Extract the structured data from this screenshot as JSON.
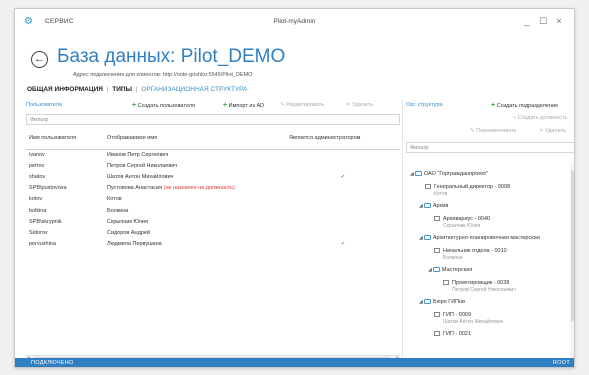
{
  "titlebar": {
    "menu_label": "СЕРВИС",
    "app_title": "Pilot-myAdmin",
    "minimize": "_",
    "maximize": "☐",
    "close": "×"
  },
  "header": {
    "title": "База данных: Pilot_DEMO",
    "address": "Адрес подключения для клиентов: http://note-grishko:5545/Pilot_DEMO"
  },
  "tabs": {
    "general": "ОБЩАЯ ИНФОРМАЦИЯ",
    "sep1": "|",
    "types": "ТИПЫ",
    "sep2": "|",
    "org": "ОРГАНИЗАЦИОННАЯ СТРУКТУРА"
  },
  "users_panel": {
    "section": "Пользователи",
    "create_user": "Создать пользователя",
    "import_ad": "Импорт из AD",
    "edit": "Редактировать",
    "delete": "Удалить",
    "filter_placeholder": "Фильтр",
    "columns": {
      "login": "Имя пользователя",
      "display": "Отображаемое имя",
      "admin": "Является администратором"
    },
    "rows": [
      {
        "login": "ivanov",
        "display": "Иванов Петр Сергеевич",
        "note": "",
        "admin": ""
      },
      {
        "login": "petrov",
        "display": "Петров Сергей Николаевич",
        "note": "",
        "admin": ""
      },
      {
        "login": "shatov",
        "display": "Шатов Антон Михайлович",
        "note": "",
        "admin": "✓"
      },
      {
        "login": "SPB\\pustovova",
        "display": "Пустовова Анастасия",
        "note": "(не назначен на должность)",
        "admin": ""
      },
      {
        "login": "kotov",
        "display": "Котов",
        "note": "",
        "admin": ""
      },
      {
        "login": "bolkina",
        "display": "Болкина",
        "note": "",
        "admin": ""
      },
      {
        "login": "SPB\\skrypnik",
        "display": "Скрыпник Юлия",
        "note": "",
        "admin": ""
      },
      {
        "login": "Sidorov",
        "display": "Сидоров Андрей",
        "note": "",
        "admin": ""
      },
      {
        "login": "pervushina",
        "display": "Людмила Первушина",
        "note": "",
        "admin": "✓"
      }
    ]
  },
  "org_panel": {
    "section": "Орг. структура",
    "create_unit": "Создать подразделение",
    "create_position": "Создать должность",
    "rename": "Переименовать",
    "delete": "Удалить",
    "filter_placeholder": "Фильтр",
    "tree": [
      {
        "title": "ОАО \"Горгражданпроект\"",
        "sub": "",
        "type": "folder",
        "level": 0,
        "toggle": "◢"
      },
      {
        "title": "Генеральный директор - 0008",
        "sub": "Котов",
        "type": "person",
        "level": 1,
        "toggle": ""
      },
      {
        "title": "Архив",
        "sub": "",
        "type": "folder",
        "level": 1,
        "toggle": "◢"
      },
      {
        "title": "Архивариус - 0040",
        "sub": "Скрыпник Юлия",
        "type": "person",
        "level": 2,
        "toggle": ""
      },
      {
        "title": "Архитектурно-планировочная мастерская",
        "sub": "",
        "type": "folder",
        "level": 1,
        "toggle": "◢"
      },
      {
        "title": "Начальник отдела - 0010",
        "sub": "Болкина",
        "type": "person",
        "level": 2,
        "toggle": ""
      },
      {
        "title": "Мастерская",
        "sub": "",
        "type": "folder",
        "level": 2,
        "toggle": "◢"
      },
      {
        "title": "Проектировщик - 0028",
        "sub": "Петров Сергей Николаевич",
        "type": "person",
        "level": 3,
        "toggle": ""
      },
      {
        "title": "Бюро ГИПов",
        "sub": "",
        "type": "folder",
        "level": 1,
        "toggle": "◢"
      },
      {
        "title": "ГИП - 0009",
        "sub": "Шатов Антон Михайлович",
        "type": "person",
        "level": 2,
        "toggle": ""
      },
      {
        "title": "ГИП - 0021",
        "sub": "",
        "type": "person",
        "level": 2,
        "toggle": ""
      }
    ]
  },
  "statusbar": {
    "left": "ПОДКЛЮЧЕНО",
    "right": "ROOT"
  },
  "colors": {
    "accent": "#2f7fc2",
    "add_green": "#3aa13a",
    "warning_red": "#e03030"
  }
}
